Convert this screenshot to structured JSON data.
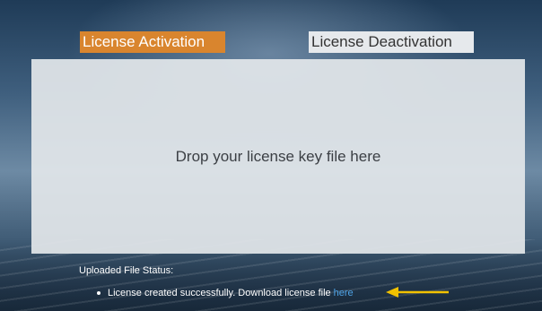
{
  "tabs": {
    "activation_label": "License Activation",
    "deactivation_label": "License Deactivation"
  },
  "dropzone": {
    "text": "Drop your license key file here"
  },
  "status": {
    "label": "Uploaded File Status:",
    "message": "License created successfully. Download license file",
    "link_text": "here"
  },
  "colors": {
    "active_tab": "#d9852e",
    "inactive_tab": "#e6e9ec",
    "link": "#4ea3e6",
    "arrow": "#f2c200"
  },
  "icons": {
    "annotation": "arrow-left-icon"
  }
}
